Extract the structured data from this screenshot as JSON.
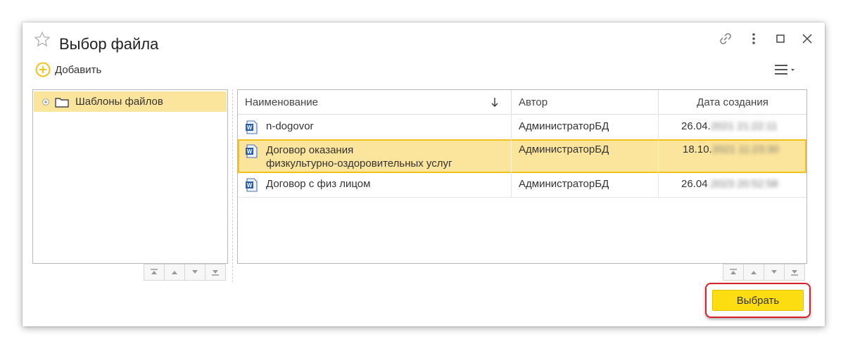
{
  "window": {
    "title": "Выбор файла"
  },
  "toolbar": {
    "add_label": "Добавить"
  },
  "tree": {
    "items": [
      {
        "label": "Шаблоны файлов"
      }
    ]
  },
  "table": {
    "columns": [
      {
        "label": "Наименование",
        "sorted": "descending"
      },
      {
        "label": "Автор"
      },
      {
        "label": "Дата создания"
      }
    ],
    "rows": [
      {
        "name": "n-dogovor",
        "author": "АдминистраторБД",
        "date_visible": "26.04.",
        "date_blurred": "2021 21:22:11",
        "selected": false
      },
      {
        "name_line1": "Договор оказания",
        "name_line2": "физкультурно-оздоровительных услуг",
        "author": "АдминистраторБД",
        "date_visible": "18.10.",
        "date_blurred": "2021 11:23:30",
        "selected": true
      },
      {
        "name": "Договор с физ лицом",
        "author": "АдминистраторБД",
        "date_visible": "26.04",
        "date_blurred": ".2023 20:52:58",
        "selected": false
      }
    ]
  },
  "footer": {
    "choose_label": "Выбрать"
  },
  "colors": {
    "selection": "#fbe49b",
    "selection_border": "#f2c21a",
    "primary_button": "#fbdd12",
    "highlight_frame": "#d6202a",
    "add_icon": "#f2c21a"
  },
  "icons": [
    "star-icon",
    "link-icon",
    "more-vertical-icon",
    "maximize-icon",
    "close-icon",
    "plus-circle-icon",
    "menu-icon",
    "expand-icon",
    "folder-icon",
    "word-document-icon",
    "sort-down-icon",
    "first-icon",
    "up-icon",
    "down-icon",
    "last-icon"
  ]
}
